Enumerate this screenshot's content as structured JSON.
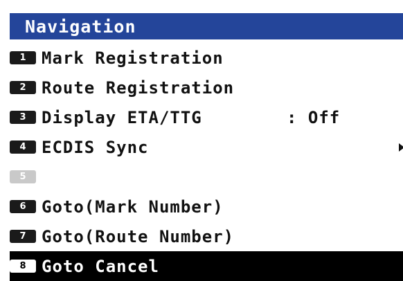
{
  "title": "Navigation",
  "colors": {
    "title_bar": "#24459a",
    "title_text": "#ffffff",
    "selected_bg": "#000000",
    "text": "#111111",
    "disabled_badge": "#c9c9c9"
  },
  "items": [
    {
      "number": "1",
      "label": "Mark Registration",
      "value": "",
      "has_submenu": false,
      "disabled": false,
      "selected": false
    },
    {
      "number": "2",
      "label": "Route Registration",
      "value": "",
      "has_submenu": false,
      "disabled": false,
      "selected": false
    },
    {
      "number": "3",
      "label": "Display ETA/TTG",
      "value": ": Off",
      "has_submenu": false,
      "disabled": false,
      "selected": false
    },
    {
      "number": "4",
      "label": "ECDIS Sync",
      "value": "",
      "has_submenu": true,
      "submenu_icon": "triangle-right-icon",
      "disabled": false,
      "selected": false
    },
    {
      "number": "5",
      "label": "",
      "value": "",
      "has_submenu": false,
      "disabled": true,
      "selected": false
    },
    {
      "number": "6",
      "label": "Goto(Mark Number)",
      "value": "",
      "has_submenu": false,
      "disabled": false,
      "selected": false
    },
    {
      "number": "7",
      "label": "Goto(Route Number)",
      "value": "",
      "has_submenu": false,
      "disabled": false,
      "selected": false
    },
    {
      "number": "8",
      "label": "Goto Cancel",
      "value": "",
      "has_submenu": false,
      "disabled": false,
      "selected": true
    }
  ]
}
